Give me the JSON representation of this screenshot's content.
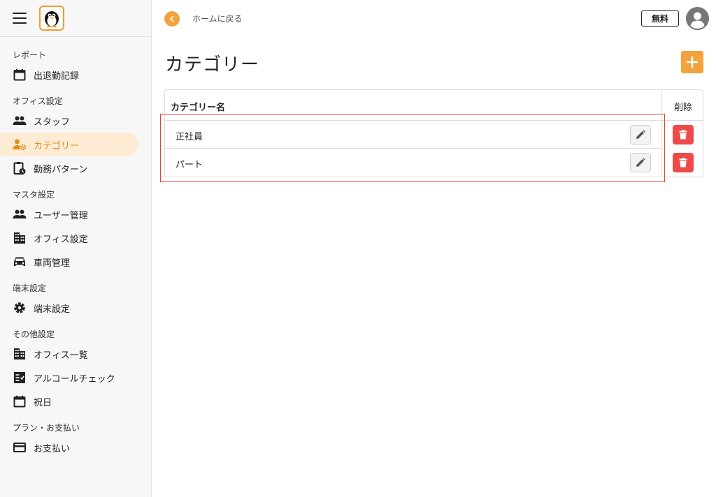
{
  "sidebar": {
    "sections": [
      {
        "label": "レポート",
        "items": [
          {
            "label": "出退勤記録",
            "icon": "calendar-icon"
          }
        ]
      },
      {
        "label": "オフィス設定",
        "items": [
          {
            "label": "スタッフ",
            "icon": "people-icon"
          },
          {
            "label": "カテゴリー",
            "icon": "person-gear-icon",
            "active": true
          },
          {
            "label": "勤務パターン",
            "icon": "clipboard-clock-icon"
          }
        ]
      },
      {
        "label": "マスタ設定",
        "items": [
          {
            "label": "ユーザー管理",
            "icon": "people-icon"
          },
          {
            "label": "オフィス設定",
            "icon": "building-icon"
          },
          {
            "label": "車両管理",
            "icon": "car-icon"
          }
        ]
      },
      {
        "label": "端末設定",
        "items": [
          {
            "label": "端末設定",
            "icon": "gear-icon"
          }
        ]
      },
      {
        "label": "その他設定",
        "items": [
          {
            "label": "オフィス一覧",
            "icon": "building-icon"
          },
          {
            "label": "アルコールチェック",
            "icon": "checklist-icon"
          },
          {
            "label": "祝日",
            "icon": "calendar-icon"
          }
        ]
      },
      {
        "label": "プラン・お支払い",
        "items": [
          {
            "label": "お支払い",
            "icon": "card-icon"
          }
        ]
      }
    ]
  },
  "header": {
    "back_label": "ホームに戻る",
    "plan_badge": "無料"
  },
  "main": {
    "title": "カテゴリー",
    "table": {
      "col_name": "カテゴリー名",
      "col_delete": "削除",
      "rows": [
        {
          "name": "正社員"
        },
        {
          "name": "パート"
        }
      ]
    }
  },
  "colors": {
    "accent": "#f3a23c",
    "active_bg": "#fdebd3",
    "delete": "#ef4a4a",
    "highlight": "#e0442c"
  }
}
